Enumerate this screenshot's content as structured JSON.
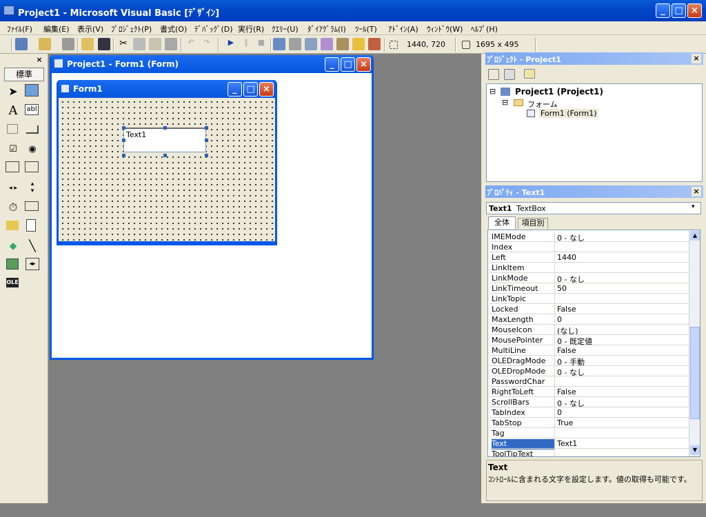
{
  "app": {
    "title": "Project1 - Microsoft Visual Basic [ﾃﾞｻﾞｲﾝ]",
    "title_controls": {
      "minimize": "_",
      "maximize": "□",
      "close": "×"
    }
  },
  "menu": [
    "ﾌｧｲﾙ(F)",
    "編集(E)",
    "表示(V)",
    "ﾌﾟﾛｼﾞｪｸﾄ(P)",
    "書式(O)",
    "ﾃﾞﾊﾞｯｸﾞ(D)",
    "実行(R)",
    "ｸｴﾘｰ(U)",
    "ﾀﾞｲｱｸﾞﾗﾑ(I)",
    "ﾂｰﾙ(T)",
    "ｱﾄﾞｲﾝ(A)",
    "ｳｨﾝﾄﾞｳ(W)",
    "ﾍﾙﾌﾟ(H)"
  ],
  "toolbar": {
    "position": "1440, 720",
    "size": "1695 x 495"
  },
  "toolbox": {
    "close": "×",
    "tab": "標準",
    "tools": [
      "pointer",
      "picture",
      "label",
      "textbox",
      "frame",
      "button",
      "checkbox",
      "option",
      "combobox",
      "listbox",
      "hscroll",
      "vscroll",
      "timer",
      "drivelist",
      "dirlist",
      "filelist",
      "shape",
      "line",
      "image",
      "data",
      "ole"
    ],
    "label_glyph": "A",
    "textbox_glyph": "abl"
  },
  "mdi": {
    "designer_title": "Project1 - Form1 (Form)",
    "form_title": "Form1",
    "textbox_text": "Text1"
  },
  "project": {
    "title": "ﾌﾟﾛｼﾞｪｸﾄ - Project1",
    "close": "×",
    "root": "Project1 (Project1)",
    "folder": "フォーム",
    "item": "Form1 (Form1)",
    "expand_root": "⊟",
    "expand_folder": "⊟"
  },
  "properties": {
    "title": "ﾌﾟﾛﾊﾟﾃｨ - Text1",
    "close": "×",
    "object_name": "Text1",
    "object_type": "TextBox",
    "tabs": [
      "全体",
      "項目別"
    ],
    "rows": [
      {
        "k": "IMEMode",
        "v": "0 - なし"
      },
      {
        "k": "Index",
        "v": ""
      },
      {
        "k": "Left",
        "v": "1440"
      },
      {
        "k": "LinkItem",
        "v": ""
      },
      {
        "k": "LinkMode",
        "v": "0 - なし"
      },
      {
        "k": "LinkTimeout",
        "v": "50"
      },
      {
        "k": "LinkTopic",
        "v": ""
      },
      {
        "k": "Locked",
        "v": "False"
      },
      {
        "k": "MaxLength",
        "v": "0"
      },
      {
        "k": "MouseIcon",
        "v": "(なし)"
      },
      {
        "k": "MousePointer",
        "v": "0 - 既定値"
      },
      {
        "k": "MultiLine",
        "v": "False"
      },
      {
        "k": "OLEDragMode",
        "v": "0 - 手動"
      },
      {
        "k": "OLEDropMode",
        "v": "0 - なし"
      },
      {
        "k": "PasswordChar",
        "v": ""
      },
      {
        "k": "RightToLeft",
        "v": "False"
      },
      {
        "k": "ScrollBars",
        "v": "0 - なし"
      },
      {
        "k": "TabIndex",
        "v": "0"
      },
      {
        "k": "TabStop",
        "v": "True"
      },
      {
        "k": "Tag",
        "v": ""
      },
      {
        "k": "Text",
        "v": "Text1"
      },
      {
        "k": "ToolTipText",
        "v": ""
      }
    ],
    "selected_row": "Text",
    "desc_title": "Text",
    "desc_text": "ｺﾝﾄﾛｰﾙに含まれる文字を設定します。値の取得も可能です。"
  },
  "colors": {
    "title_blue": "#0054e3",
    "face": "#ece9d8",
    "mdi": "#808080",
    "selection": "#316ac5"
  }
}
